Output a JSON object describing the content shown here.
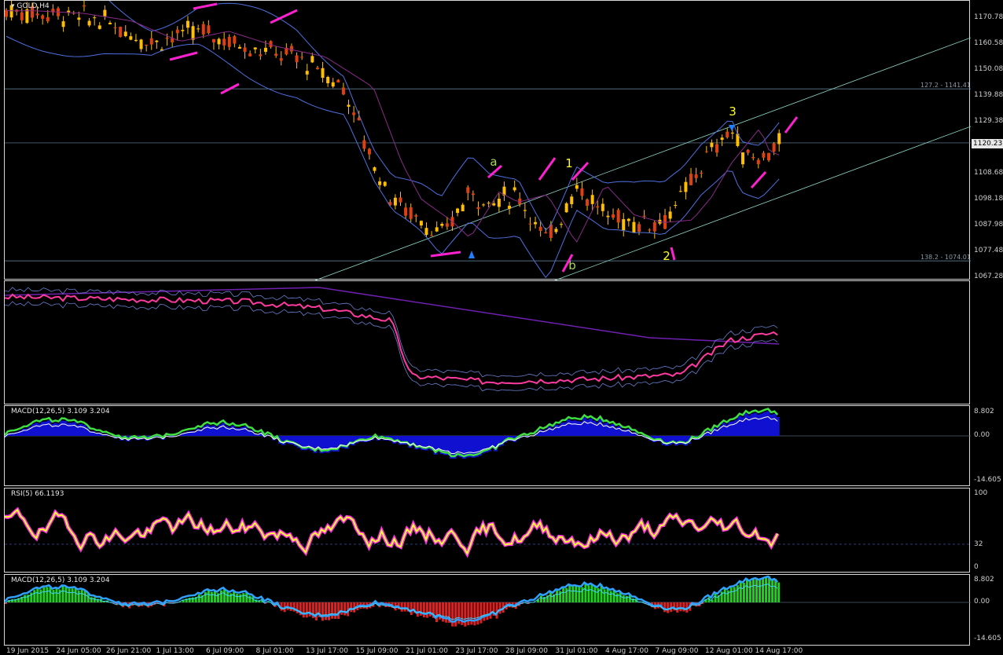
{
  "panes": [
    {
      "title": "GOLD,H4",
      "ticks": [
        "1170.78",
        "1160.58",
        "1150.08",
        "1139.88",
        "1129.38",
        "1108.68",
        "1098.18",
        "1087.98",
        "1077.48",
        "1067.28"
      ],
      "price": "1120.23",
      "levels": [
        "127.2 - 1141.41",
        "138.2 - 1074.01"
      ],
      "labels": {
        "a": "a",
        "b": "b",
        "w1": "1",
        "w2": "2",
        "w3": "3"
      }
    },
    {
      "title": ""
    },
    {
      "title": "MACD(12,26,5) 3.109 3.204",
      "ticks": [
        "8.802",
        "0.00",
        "-14.605"
      ]
    },
    {
      "title": "RSI(5) 66.1193",
      "ticks": [
        "100",
        "32",
        "0"
      ]
    },
    {
      "title": "MACD(12,26,5) 3.109 3.204",
      "ticks": [
        "8.802",
        "0.00",
        "-14.605"
      ]
    }
  ],
  "x_axis": [
    "19 Jun 2015",
    "24 Jun 05:00",
    "26 Jun 21:00",
    "1 Jul 13:00",
    "6 Jul 09:00",
    "8 Jul 01:00",
    "13 Jul 17:00",
    "15 Jul 09:00",
    "21 Jul 01:00",
    "23 Jul 17:00",
    "28 Jul 09:00",
    "31 Jul 01:00",
    "4 Aug 17:00",
    "7 Aug 09:00",
    "12 Aug 01:00",
    "14 Aug 17:00"
  ],
  "chart_data": [
    {
      "type": "candlestick",
      "title": "GOLD,H4",
      "path_x": [
        0,
        0.05,
        0.1,
        0.15,
        0.2,
        0.25,
        0.3,
        0.35,
        0.38,
        0.4,
        0.43,
        0.45,
        0.48,
        0.5,
        0.53,
        0.56,
        0.59,
        0.62,
        0.65,
        0.68,
        0.7,
        0.72,
        0.75,
        0.76,
        0.78,
        0.8
      ],
      "path_y": [
        1172,
        1171,
        1168,
        1160,
        1164,
        1158,
        1154,
        1142,
        1112,
        1098,
        1090,
        1083,
        1101,
        1097,
        1100,
        1081,
        1104,
        1092,
        1089,
        1090,
        1099,
        1112,
        1126,
        1117,
        1114,
        1120
      ],
      "ylim": [
        1067.28,
        1175
      ],
      "price": 1120.23,
      "fib_levels": [
        1141.41,
        1074.01
      ]
    },
    {
      "type": "line",
      "path_x": [
        0,
        0.25,
        0.33,
        0.4,
        0.42,
        0.5,
        0.6,
        0.7,
        0.75,
        0.8
      ],
      "path_y": [
        0.92,
        0.88,
        0.82,
        0.72,
        0.25,
        0.2,
        0.22,
        0.26,
        0.55,
        0.62
      ],
      "ylim": [
        0,
        1
      ]
    },
    {
      "type": "bar",
      "title": "MACD(12,26,5) 3.109 3.204",
      "ylim": [
        -14.605,
        8.802
      ]
    },
    {
      "type": "line",
      "title": "RSI(5) 66.1193",
      "ylim": [
        0,
        100
      ],
      "levels": [
        32
      ]
    },
    {
      "type": "bar",
      "title": "MACD(12,26,5) 3.109 3.204",
      "ylim": [
        -14.605,
        8.802
      ]
    }
  ]
}
